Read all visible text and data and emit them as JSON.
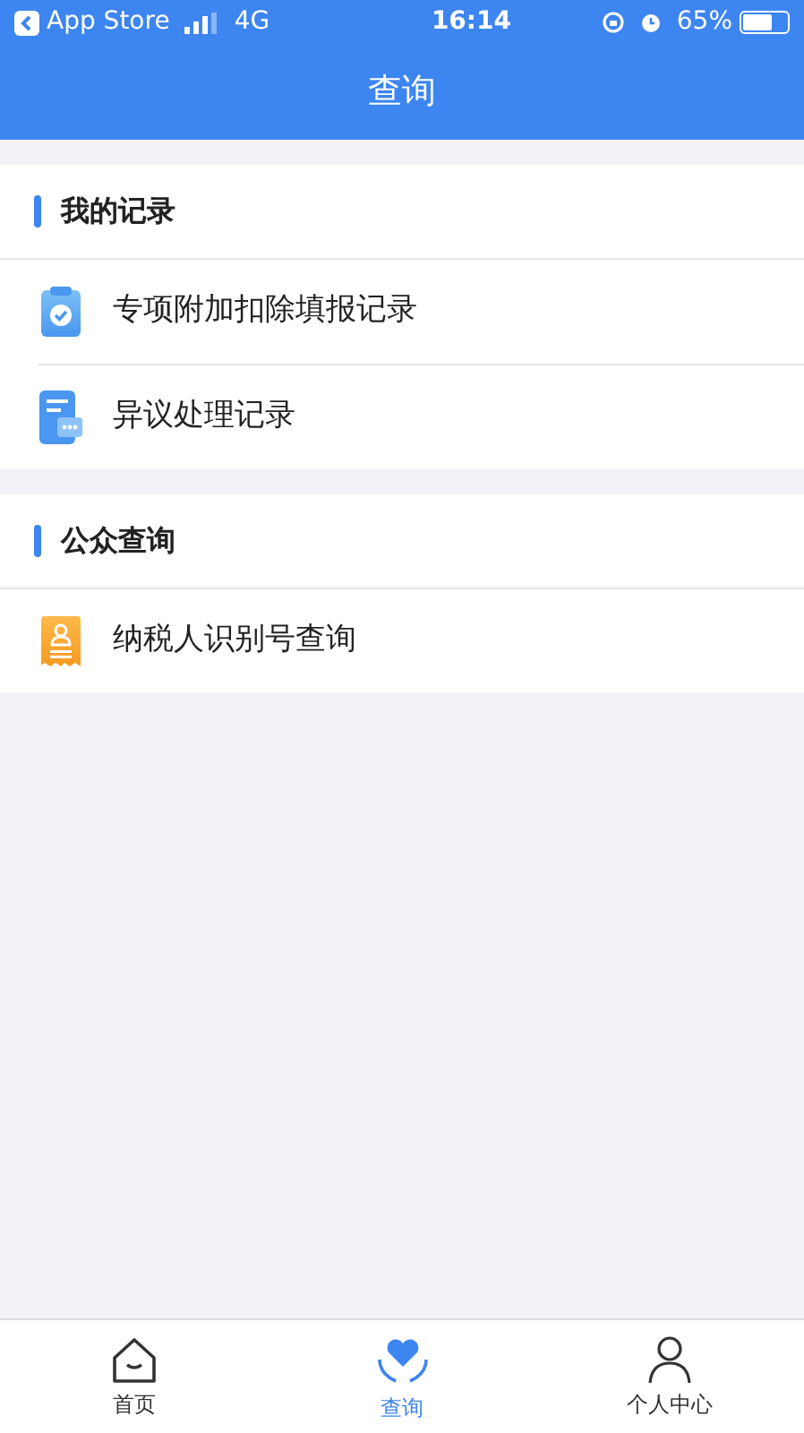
{
  "status_bar": {
    "back_label": "App Store",
    "network": "4G",
    "time": "16:14",
    "battery": "65%"
  },
  "title": "查询",
  "sections": [
    {
      "title": "我的记录",
      "items": [
        {
          "label": "专项附加扣除填报记录",
          "kind": "clipboard"
        },
        {
          "label": "异议处理记录",
          "kind": "chat"
        }
      ]
    },
    {
      "title": "公众查询",
      "items": [
        {
          "label": "纳税人识别号查询",
          "kind": "id"
        }
      ]
    }
  ],
  "tabs": [
    {
      "label": "首页",
      "kind": "home",
      "selected": false
    },
    {
      "label": "查询",
      "kind": "heart",
      "selected": true
    },
    {
      "label": "个人中心",
      "kind": "person",
      "selected": false
    }
  ]
}
